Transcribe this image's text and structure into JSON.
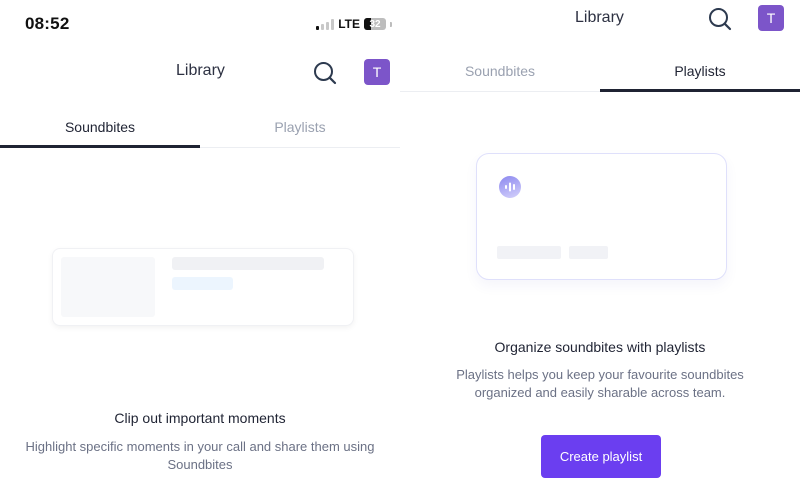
{
  "status_bar": {
    "time": "08:52",
    "network": "LTE",
    "battery_percent": 32,
    "battery_label": "32",
    "signal_bars_on": 1,
    "signal_bars_total": 4
  },
  "header": {
    "title": "Library",
    "search_icon": "search-icon",
    "avatar_initial": "T",
    "avatar_color": "#7c55c9"
  },
  "tabs": [
    {
      "label": "Soundbites"
    },
    {
      "label": "Playlists"
    }
  ],
  "screens": {
    "soundbites": {
      "active_tab": "Soundbites",
      "empty_title": "Clip out important moments",
      "empty_description": "Highlight specific moments in your call and share them using Soundbites"
    },
    "playlists": {
      "active_tab": "Playlists",
      "card_icon": "soundwave-icon",
      "empty_title": "Organize soundbites with playlists",
      "empty_description": "Playlists helps you keep your favourite soundbites organized and easily sharable across team.",
      "create_button_label": "Create playlist",
      "accent_color": "#6b3ef0"
    }
  }
}
